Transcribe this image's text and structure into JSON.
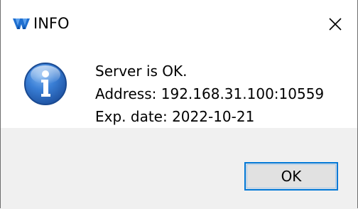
{
  "window": {
    "title": "INFO",
    "app_icon": "gowin-logo-icon",
    "close_icon": "close-icon"
  },
  "message": {
    "icon": "information-icon",
    "lines": [
      "Server is OK.",
      "Address: 192.168.31.100:10559",
      "Exp. date: 2022-10-21"
    ]
  },
  "buttons": {
    "ok_label": "OK"
  },
  "colors": {
    "accent": "#0078d7",
    "info_icon_blue": "#2d6fc4",
    "footer_bg": "#f0f0f0",
    "button_bg": "#e1e1e1",
    "logo_blue": "#1f6fd0"
  }
}
